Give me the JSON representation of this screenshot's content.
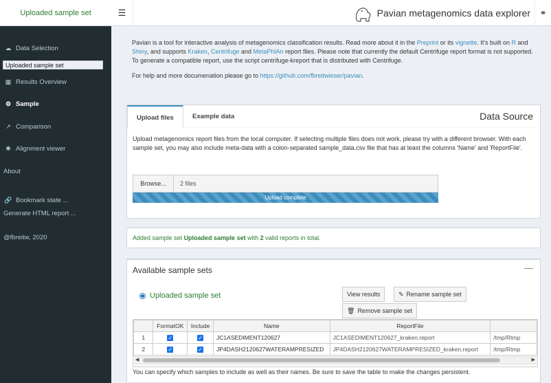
{
  "logo": "Uploaded sample set",
  "navbar": {
    "menu_icon": "hamburger-icon",
    "title": "Pavian metagenomics data explorer",
    "github_icon": "github-icon"
  },
  "sidebar": {
    "data_selection": "Data Selection",
    "selected_sample_set": "Uploaded sample set",
    "results_overview": "Results Overview",
    "sample": "Sample",
    "comparison": "Comparison",
    "alignment_viewer": "Alignment viewer",
    "about": "About",
    "bookmark": "Bookmark state ...",
    "generate_html": "Generate HTML report ...",
    "copyright": "@fbreitw, 2020"
  },
  "intro": {
    "p1_a": "Pavian is a tool for interactive analysis of metagenomics classification results. Read more about it in the ",
    "preprint": "Preprint",
    "p1_b": " or its ",
    "vignette": "vignette",
    "p1_c": ". It's built on ",
    "r": "R",
    "p1_d": " and ",
    "shiny": "Shiny",
    "p1_e": ", and supports ",
    "kraken": "Kraken",
    "p1_f": ", ",
    "centrifuge": "Centrifuge",
    "p1_g": " and ",
    "metaphlan": "MetaPhlAn",
    "p1_h": " report files. Please note that currently the default Centrifuge report format is not supported. To generate a compatible report, use the script centrifuge-kreport that is distributed with Centrifuge.",
    "p2_a": "For help and more documenation please go to ",
    "github_url": "https://github.com/fbreitwieser/pavian",
    "p2_b": "."
  },
  "data_source": {
    "tabs": [
      "Upload files",
      "Example data"
    ],
    "title": "Data Source",
    "description": "Upload metagenomics report files from the local computer. If selecting multiple files does not work, please try with a different browser. With each sample set, you may also include meta-data with a colon-separated sample_data.csv file that has at least the columns 'Name' and 'ReportFile'.",
    "browse_label": "Browse...",
    "files_value": "2 files",
    "progress_label": "Upload complete",
    "progress_value": 1.0
  },
  "message": {
    "a": "Added sample set ",
    "b": "Uploaded sample set",
    "c": " with ",
    "d": "2",
    "e": " valid reports in total."
  },
  "sample_sets": {
    "title": "Available sample sets",
    "collapse_icon": "minus-icon",
    "radio_label": "Uploaded sample set",
    "view_results": "View results",
    "rename": "Rename sample set",
    "remove": "Remove sample set",
    "columns": [
      "",
      "FormatOK",
      "Include",
      "Name",
      "ReportFile",
      ""
    ],
    "rows": [
      {
        "num": "1",
        "name": "JC1ASEDIMENT120627",
        "report": "JC1ASEDIMENT120627_kraken.report",
        "path": "/tmp/Rtmp"
      },
      {
        "num": "2",
        "name": "JP4DASH2120627WATERAMPRESIZED",
        "report": "JP4DASH2120627WATERAMPRESIZED_kraken.report",
        "path": "/tmp/Rtmp"
      }
    ],
    "footer": "You can specify which samples to include as well as their names. Be sure to save the table to make the changes persistent."
  }
}
